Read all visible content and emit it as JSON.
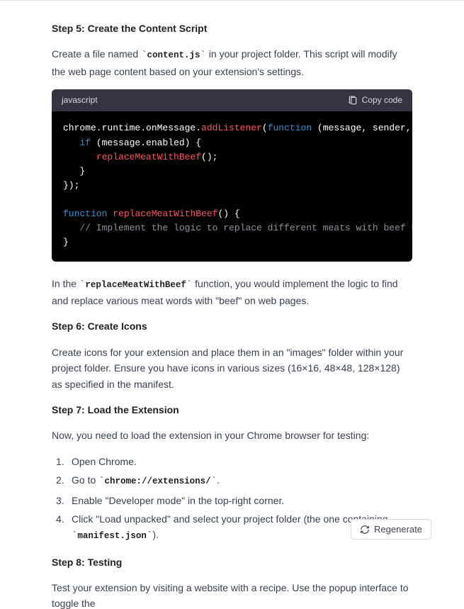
{
  "step5": {
    "heading": "Step 5: Create the Content Script",
    "para_before": "Create a file named ",
    "code_inline": "content.js",
    "para_after": " in your project folder. This script will modify the web page content based on your extension's settings."
  },
  "codeblock": {
    "lang": "javascript",
    "copy_label": "Copy code",
    "lines": {
      "l1a": "chrome.runtime.onMessage.",
      "l1b": "addListener",
      "l1c": "(",
      "l1d": "function",
      "l1e": " (message, sender, sendResponse",
      "l2a": "   ",
      "l2b": "if",
      "l2c": " (message.enabled) {",
      "l3a": "      ",
      "l3b": "replaceMeatWithBeef",
      "l3c": "();",
      "l4": "   }",
      "l5": "});",
      "blank": "",
      "l6a": "function",
      "l6b": " ",
      "l6c": "replaceMeatWithBeef",
      "l6d": "() {",
      "l7": "   // Implement the logic to replace different meats with beef here",
      "l8": "}"
    }
  },
  "after_code": {
    "before": "In the ",
    "code_inline": "replaceMeatWithBeef",
    "after": " function, you would implement the logic to find and replace various meat words with \"beef\" on web pages."
  },
  "step6": {
    "heading": "Step 6: Create Icons",
    "para": "Create icons for your extension and place them in an \"images\" folder within your project folder. Ensure you have icons in various sizes (16×16, 48×48, 128×128) as specified in the manifest."
  },
  "step7": {
    "heading": "Step 7: Load the Extension",
    "para": "Now, you need to load the extension in your Chrome browser for testing:",
    "li1": "Open Chrome.",
    "li2_before": "Go to ",
    "li2_code": "chrome://extensions/",
    "li2_after": ".",
    "li3": "Enable \"Developer mode\" in the top-right corner.",
    "li4_before": "Click \"Load unpacked\" and select your project folder (the one containing ",
    "li4_code": "manifest.json",
    "li4_after": ")."
  },
  "step8": {
    "heading": "Step 8: Testing",
    "para": "Test your extension by visiting a website with a recipe. Use the popup interface to toggle the"
  },
  "regen": {
    "label": "Regenerate"
  }
}
